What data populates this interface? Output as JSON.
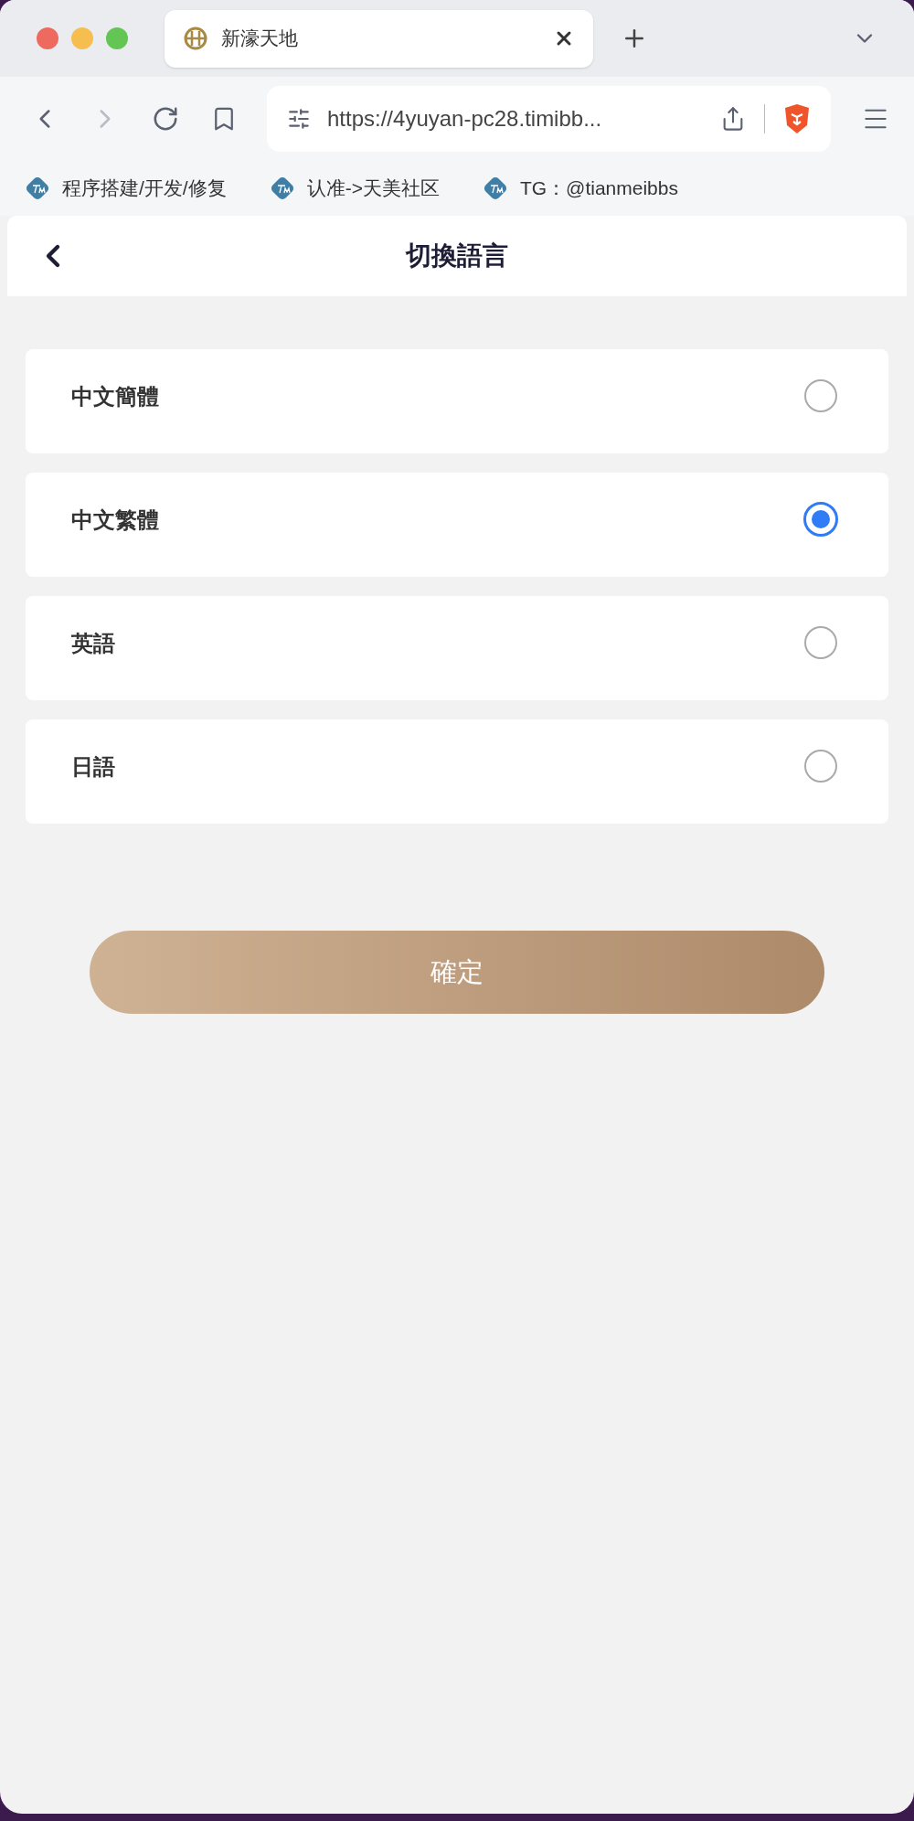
{
  "browser": {
    "tab": {
      "title": "新濠天地"
    },
    "address": {
      "url": "https://4yuyan-pc28.timibb..."
    },
    "bookmarks": [
      {
        "label": "程序搭建/开发/修复"
      },
      {
        "label": "认准->天美社区"
      },
      {
        "label": "TG：@tianmeibbs"
      }
    ]
  },
  "page": {
    "title": "切換語言",
    "languages": [
      {
        "label": "中文簡體",
        "selected": false
      },
      {
        "label": "中文繁體",
        "selected": true
      },
      {
        "label": "英語",
        "selected": false
      },
      {
        "label": "日語",
        "selected": false
      }
    ],
    "confirm_button": "確定"
  }
}
